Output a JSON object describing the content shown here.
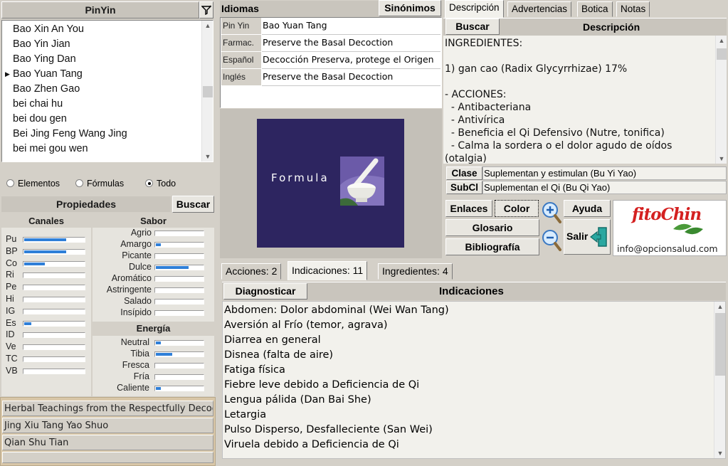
{
  "pinyin": {
    "header": "PinYin",
    "items": [
      "Bao Xin An You",
      "Bao Yin Jian",
      "Bao Ying Dan",
      "Bao Yuan Tang",
      "Bao Zhen Gao",
      "bei chai hu",
      "bei dou gen",
      "Bei Jing Feng Wang Jing",
      "bei mei gou wen"
    ],
    "selected_index": 3
  },
  "filter": {
    "options": [
      "Elementos",
      "Fórmulas",
      "Todo"
    ],
    "selected": "Todo"
  },
  "propiedades": {
    "title": "Propiedades",
    "search_label": "Buscar",
    "canales": {
      "title": "Canales",
      "items": [
        {
          "label": "Pu",
          "level": 0.7
        },
        {
          "label": "BP",
          "level": 0.7
        },
        {
          "label": "Co",
          "level": 0.35
        },
        {
          "label": "Ri",
          "level": 0
        },
        {
          "label": "Pe",
          "level": 0
        },
        {
          "label": "Hi",
          "level": 0
        },
        {
          "label": "IG",
          "level": 0
        },
        {
          "label": "Es",
          "level": 0.12
        },
        {
          "label": "ID",
          "level": 0
        },
        {
          "label": "Ve",
          "level": 0
        },
        {
          "label": "TC",
          "level": 0
        },
        {
          "label": "VB",
          "level": 0
        }
      ]
    },
    "sabor": {
      "title": "Sabor",
      "items": [
        {
          "label": "Agrio",
          "level": 0
        },
        {
          "label": "Amargo",
          "level": 0.1
        },
        {
          "label": "Picante",
          "level": 0
        },
        {
          "label": "Dulce",
          "level": 0.7
        },
        {
          "label": "Aromático",
          "level": 0
        },
        {
          "label": "Astringente",
          "level": 0
        },
        {
          "label": "Salado",
          "level": 0
        },
        {
          "label": "Insípido",
          "level": 0
        }
      ]
    },
    "energia": {
      "title": "Energía",
      "items": [
        {
          "label": "Neutral",
          "level": 0.1
        },
        {
          "label": "Tibia",
          "level": 0.35
        },
        {
          "label": "Fresca",
          "level": 0
        },
        {
          "label": "Fría",
          "level": 0
        },
        {
          "label": "Caliente",
          "level": 0.1
        }
      ]
    }
  },
  "references": [
    "Herbal Teachings from the Respectfully Decoct",
    "Jing Xiu Tang Yao Shuo",
    "Qian Shu Tian"
  ],
  "idiomas": {
    "title": "Idiomas",
    "synonyms_label": "Sinónimos",
    "rows": [
      {
        "key": "Pin Yin",
        "value": "Bao Yuan Tang"
      },
      {
        "key": "Farmac.",
        "value": "Preserve the Basal Decoction"
      },
      {
        "key": "Español",
        "value": "Decocción Preserva, protege el Origen"
      },
      {
        "key": "Inglés",
        "value": "Preserve the Basal Decoction"
      }
    ]
  },
  "formula_image": {
    "caption": "Formula"
  },
  "right_tabs": [
    "Descripción",
    "Advertencias",
    "Botica",
    "Notas"
  ],
  "descripcion": {
    "search_label": "Buscar",
    "title": "Descripción",
    "text": "INGREDIENTES:\n\n1) gan cao (Radix Glycyrrhizae) 17%\n\n- ACCIONES:\n  - Antibacteriana\n  - Antivírica\n  - Beneficia el Qi Defensivo (Nutre, tonifica)\n  - Calma la sordera o el dolor agudo de oídos\n(otalgia)"
  },
  "clase": {
    "label": "Clase",
    "value": "Suplementan y estimulan (Bu Yi Yao)"
  },
  "subcl": {
    "label": "SubCl",
    "value": "Suplementan el Qi (Bu Qi Yao)"
  },
  "buttons": {
    "enlaces": "Enlaces",
    "color": "Color",
    "glosario": "Glosario",
    "bibliografia": "Bibliografía",
    "ayuda": "Ayuda",
    "salir": "Salir"
  },
  "logo": {
    "brand": "fitoChin",
    "email": "info@opcionsalud.com"
  },
  "bottom_tabs": [
    "Acciones: 2",
    "Indicaciones: 11",
    "Ingredientes: 4"
  ],
  "indicaciones": {
    "diagnose_label": "Diagnosticar",
    "title": "Indicaciones",
    "items": [
      "Abdomen: Dolor abdominal (Wei Wan Tang)",
      "Aversión al Frío (temor, agrava)",
      "Diarrea en general",
      "Disnea (falta de aire)",
      "Fatiga física",
      "Fiebre leve debido a Deficiencia de Qi",
      "Lengua pálida (Dan Bai She)",
      "Letargia",
      "Pulso Disperso, Desfalleciente (San Wei)",
      "Viruela debido a Deficiencia de Qi"
    ]
  },
  "colors": {
    "accent_bar": "#2f7fd8",
    "formula_bg": "#2d2560",
    "logo_red": "#d42020"
  }
}
